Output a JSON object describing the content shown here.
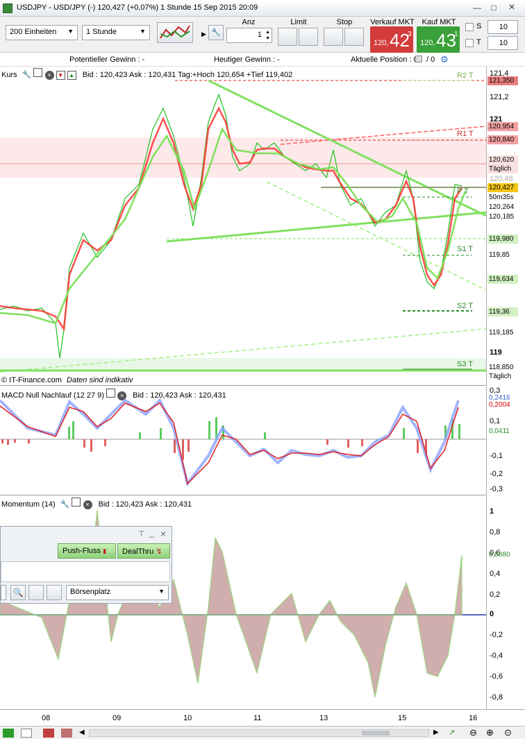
{
  "window": {
    "title": "USDJPY - USD/JPY (-)   120,427 (+0,07%)   1 Stunde  15 Sep 2015 20:09"
  },
  "toolbar": {
    "units": "200 Einheiten",
    "interval": "1 Stunde",
    "anz_label": "Anz",
    "anz_value": "1",
    "limit_label": "Limit",
    "stop_label": "Stop",
    "sell_label": "Verkauf MKT",
    "buy_label": "Kauf MKT",
    "sell_small": "120,",
    "sell_big": "42",
    "sell_sup": "3",
    "buy_small": "120,",
    "buy_big": "43",
    "buy_sup": "1",
    "s_label": "S",
    "t_label": "T",
    "s_value": "10",
    "t_value": "10"
  },
  "infobar": {
    "potential": "Potentieller Gewinn : -",
    "today": "Heutiger Gewinn : -",
    "position": "Aktuelle Position : 0",
    "slash": "/ 0"
  },
  "price_panel": {
    "name": "Kurs",
    "quote": "Bid : 120,423 Ask : 120,431 Tag:+Hoch 120,654 +Tief 119,402",
    "credit": "© IT-Finance.com",
    "disclaimer": "Daten sind indikativ",
    "axis_labels": [
      "121,4",
      "121,2",
      "121",
      "120,6",
      "120,48",
      "119,8",
      "119,6",
      "119,4",
      "119"
    ],
    "tags": [
      {
        "text": "121,350",
        "bg": "#e88080"
      },
      {
        "text": "120,954",
        "bg": "#f2a0a0"
      },
      {
        "text": "120,840",
        "bg": "#f2a0a0"
      },
      {
        "text": "120,620",
        "bg": "#f8e0e0"
      },
      {
        "text": "Täglich",
        "bg": "#f8e0e0"
      },
      {
        "text": "120,427",
        "bg": "#f5c518"
      },
      {
        "text": "50m35s",
        "bg": "#ffffff"
      },
      {
        "text": "120,264",
        "bg": "#ffffff"
      },
      {
        "text": "120,185",
        "bg": "#ffffff"
      },
      {
        "text": "119,980",
        "bg": "#d0f0c0"
      },
      {
        "text": "119,85",
        "bg": "#ffffff"
      },
      {
        "text": "119,634",
        "bg": "#d0f0c0"
      },
      {
        "text": "119,36",
        "bg": "#d0f0c0"
      },
      {
        "text": "119,185",
        "bg": "#ffffff"
      },
      {
        "text": "118,850",
        "bg": "#ffffff"
      },
      {
        "text": "Täglich",
        "bg": "#ffffff"
      }
    ],
    "pivots": [
      "R2 T",
      "R1 T",
      "P T",
      "S1 T",
      "S2 T",
      "S3 T"
    ]
  },
  "macd_panel": {
    "name": "MACD Null Nachlauf (12 27 9)",
    "quote": "Bid : 120,423 Ask : 120,431",
    "axis_labels": [
      "0,3",
      "0,1",
      "-0,1",
      "-0,2",
      "-0,3"
    ],
    "tags": [
      {
        "text": "0,2416",
        "color": "#3366cc"
      },
      {
        "text": "0,2004",
        "color": "#cc0000"
      },
      {
        "text": "0,0411",
        "color": "#2a8a2a"
      }
    ]
  },
  "momentum_panel": {
    "name": "Momentum (14)",
    "quote": "Bid : 120,423 Ask : 120,431",
    "axis_labels": [
      "1",
      "0,8",
      "0,6",
      "0,4",
      "0,2",
      "0",
      "-0,2",
      "-0,4",
      "-0,6",
      "-0,8"
    ],
    "tag": "0,5880"
  },
  "float_window": {
    "push_label": "Push-Fluss",
    "dealthru_label": "DealThru",
    "boerse_label": "Börsenplatz"
  },
  "x_axis": [
    "08",
    "09",
    "10",
    "11",
    "13",
    "15",
    "16"
  ]
}
